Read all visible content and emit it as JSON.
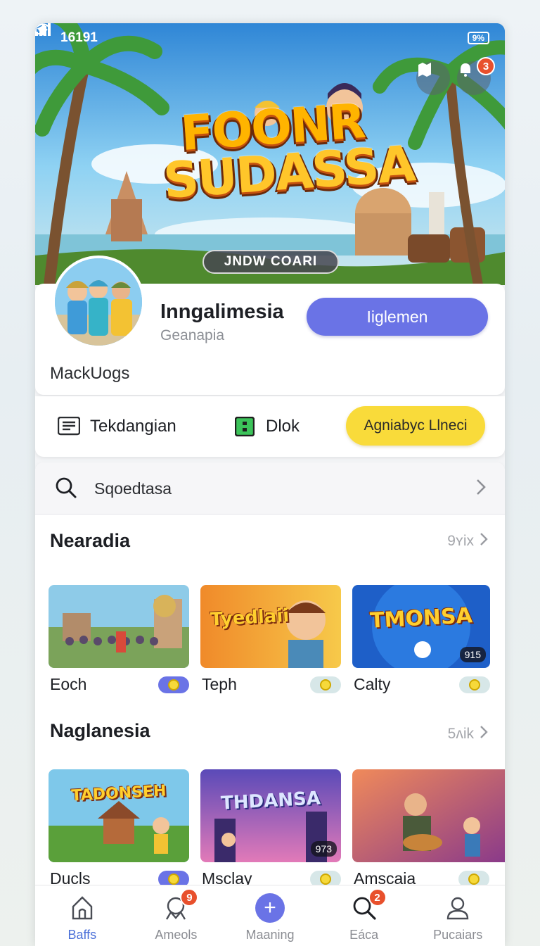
{
  "status_bar": {
    "time": "16191",
    "battery": "9%"
  },
  "hero": {
    "logo_line1": "FOONR",
    "logo_line2": "SUDASSA",
    "pill_label": "JNDW COARI",
    "right_badge": "3"
  },
  "profile": {
    "name": "Inngalimesia",
    "subtitle": "Geanapia",
    "primary_button": "Iiglemen",
    "tag": "MackUogs"
  },
  "actions": {
    "item1": "Tekdangian",
    "item2": "Dlok",
    "yellow_button": "Agniabyc Llneci"
  },
  "search": {
    "placeholder": "Sqoedtasa"
  },
  "sections": [
    {
      "title": "Nearadia",
      "more": "9ʏix",
      "cards": [
        {
          "title": "Eoch",
          "thumb_label": "",
          "count": ""
        },
        {
          "title": "Teph",
          "thumb_label": "Tyedlaii",
          "count": ""
        },
        {
          "title": "Calty",
          "thumb_label": "TMONSA",
          "count": "915"
        }
      ]
    },
    {
      "title": "Naglanesia",
      "more": "5ʌik",
      "cards": [
        {
          "title": "Ducls",
          "thumb_label": "TADONSEH",
          "count": ""
        },
        {
          "title": "Msclay",
          "thumb_label": "THDANSA",
          "count": "973"
        },
        {
          "title": "Amscaia",
          "thumb_label": "",
          "count": ""
        }
      ]
    }
  ],
  "bottom_nav": [
    {
      "label": "Baffs",
      "badge": "",
      "active": true
    },
    {
      "label": "Ameols",
      "badge": "9",
      "active": false
    },
    {
      "label": "Maaning",
      "badge": "",
      "active": false
    },
    {
      "label": "Eáca",
      "badge": "2",
      "active": false
    },
    {
      "label": "Pucaiars",
      "badge": "",
      "active": false
    }
  ],
  "colors": {
    "accent": "#6a73e6",
    "yellow": "#f9db3a",
    "badge": "#e8502c",
    "active_nav": "#4a6fd8"
  }
}
